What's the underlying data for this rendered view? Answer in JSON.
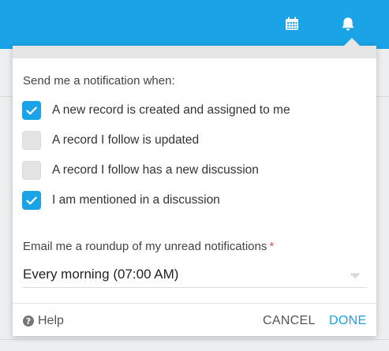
{
  "colors": {
    "topbar": "#1aa3e6",
    "accent": "#1aa3e6",
    "required": "#d9534f"
  },
  "topbar": {
    "icons": [
      "calendar-icon",
      "bell-icon"
    ]
  },
  "popover": {
    "section_title": "Send me a notification when:",
    "options": [
      {
        "label": "A new record is created and assigned to me",
        "checked": true
      },
      {
        "label": "A record I follow is updated",
        "checked": false
      },
      {
        "label": "A record I follow has a new discussion",
        "checked": false
      },
      {
        "label": "I am mentioned in a discussion",
        "checked": true
      }
    ],
    "email_label": "Email me a roundup of my unread notifications",
    "required_marker": "*",
    "email_value": "Every morning (07:00 AM)",
    "footer": {
      "help_icon": "?",
      "help_label": "Help",
      "cancel_label": "CANCEL",
      "done_label": "DONE"
    }
  }
}
